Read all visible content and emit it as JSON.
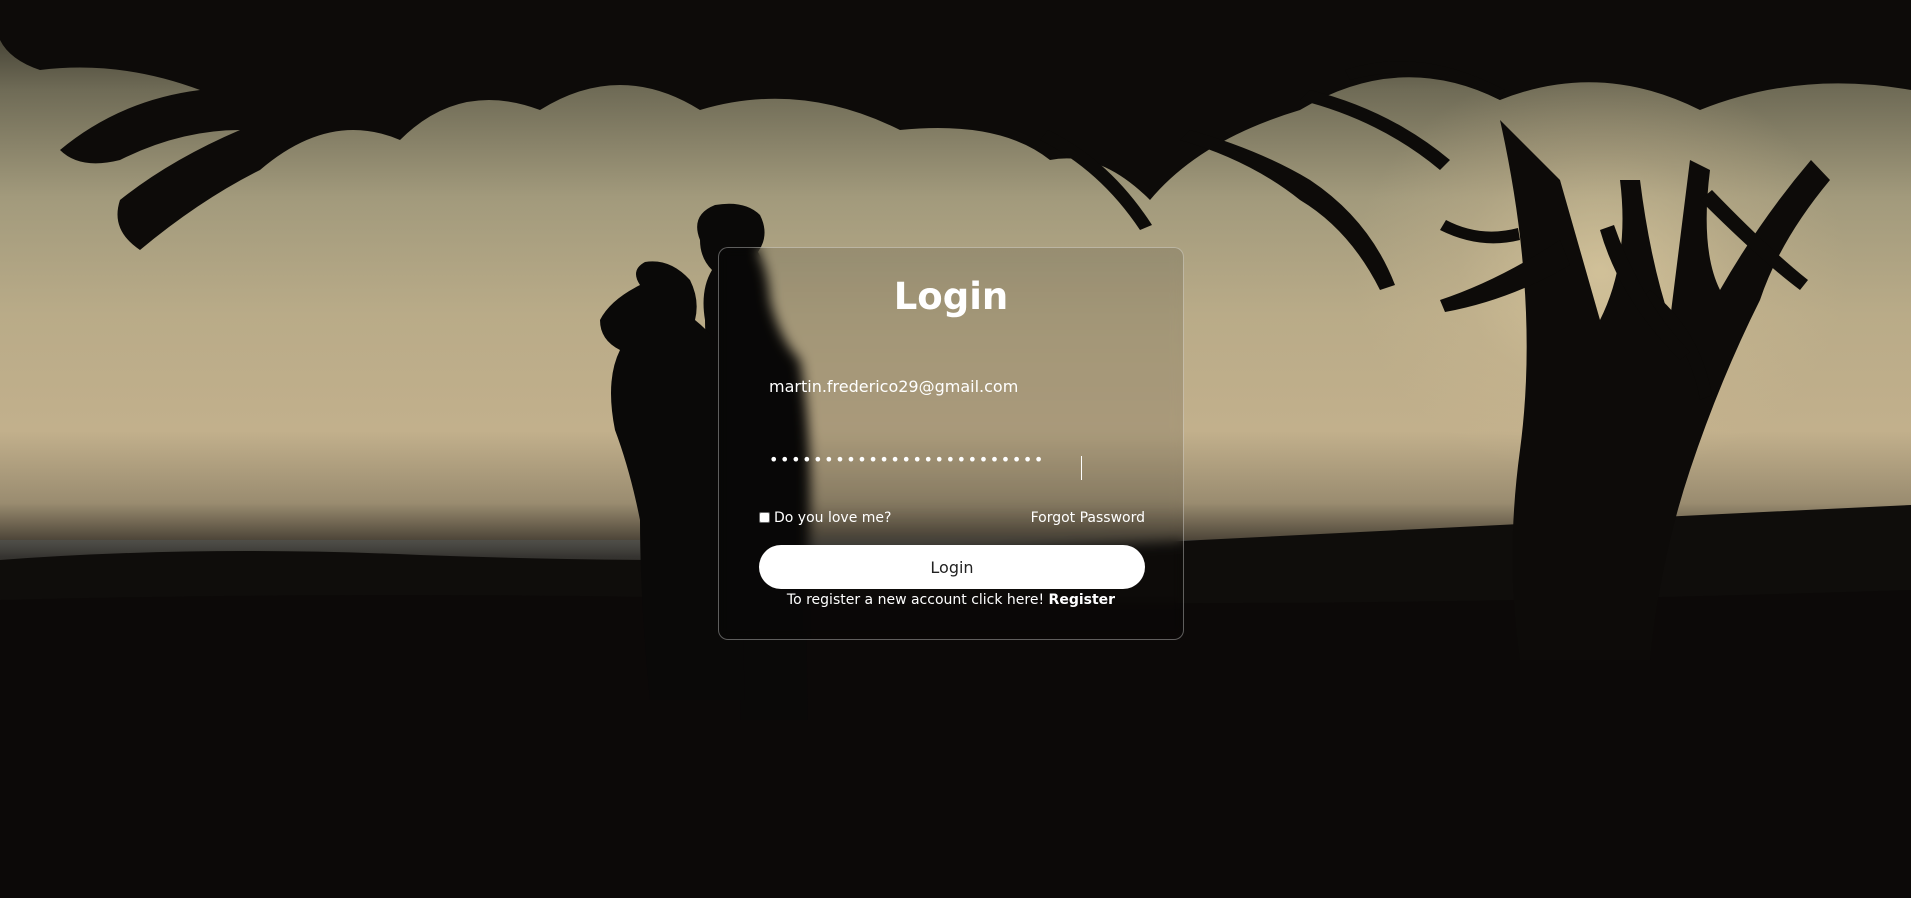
{
  "page": {
    "background_description_colors": {
      "sky": "#b9ab88",
      "ground": "#0c0a09"
    }
  },
  "login_form": {
    "title": "Login",
    "email_value": "martin.frederico29@gmail.com",
    "password_masked": "•••••••••••••••••••••••••",
    "remember_label": "Do you love me?",
    "remember_checked": false,
    "forgot_label": "Forgot Password",
    "submit_label": "Login",
    "register_prompt": "To register a new account click here!",
    "register_link": "Register"
  }
}
